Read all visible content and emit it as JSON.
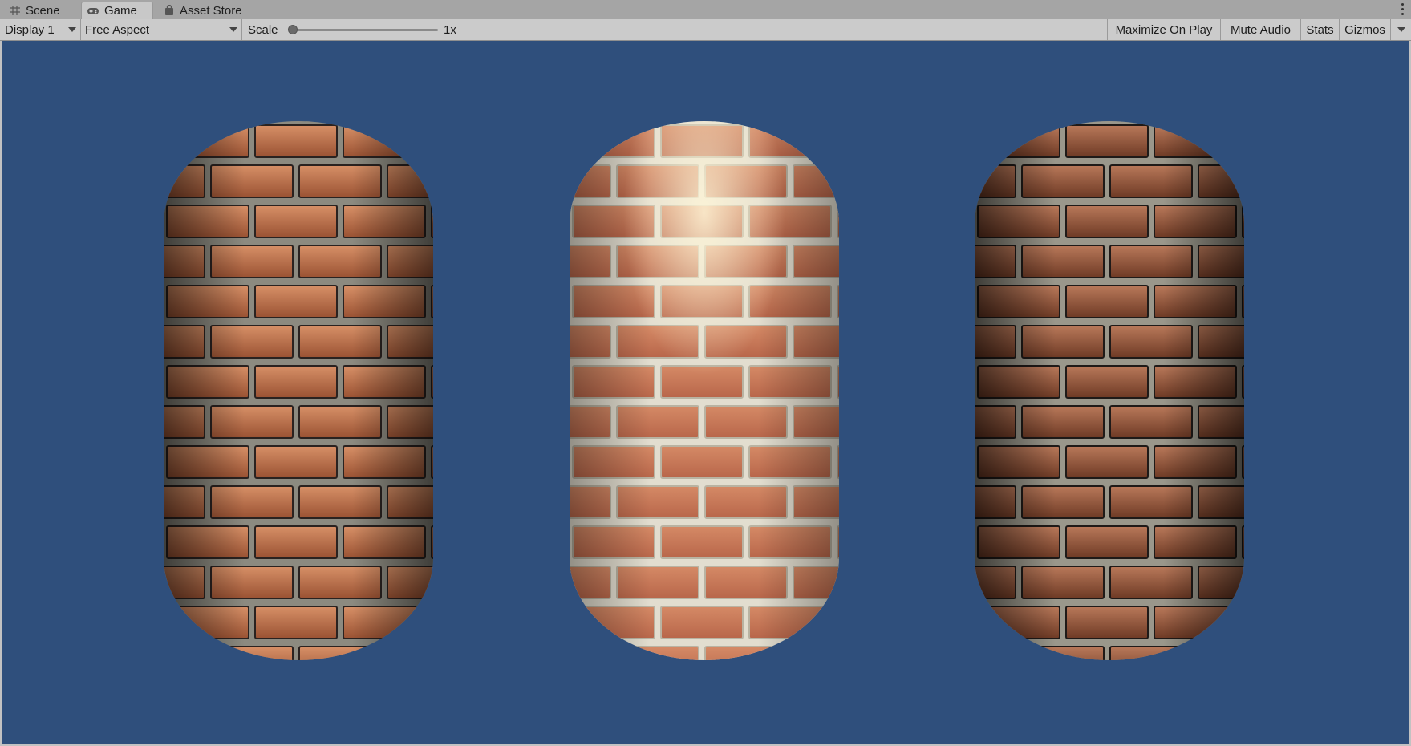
{
  "tabs": [
    {
      "label": "Scene",
      "icon": "grid-icon"
    },
    {
      "label": "Game",
      "icon": "gamepad-icon",
      "active": true
    },
    {
      "label": "Asset Store",
      "icon": "shopping-bag-icon"
    }
  ],
  "toolbar": {
    "display": "Display 1",
    "aspect": "Free Aspect",
    "scale_label": "Scale",
    "scale_value": "1x",
    "maximize": "Maximize On Play",
    "mute": "Mute Audio",
    "stats": "Stats",
    "gizmos": "Gizmos"
  },
  "viewport": {
    "background": "#2f4f7c",
    "objects": [
      {
        "name": "brick-capsule-left",
        "shading": "shiny-metallic"
      },
      {
        "name": "brick-capsule-middle",
        "shading": "diffuse-with-highlight"
      },
      {
        "name": "brick-capsule-right",
        "shading": "dark-glossy"
      }
    ]
  },
  "colors": {
    "brick": "#b86a48",
    "mortar": "#d9d6c8"
  }
}
